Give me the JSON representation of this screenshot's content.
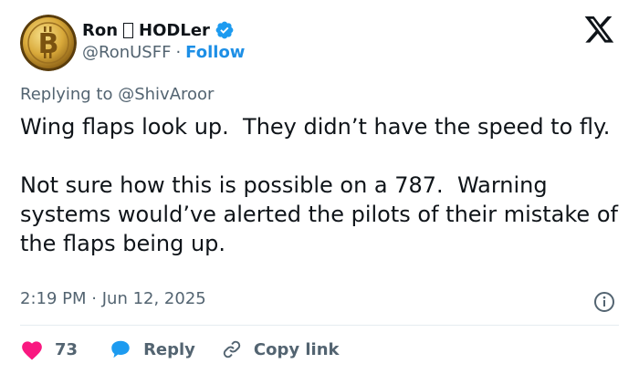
{
  "user": {
    "display_name": "Ron",
    "display_name_suffix": "HODLer",
    "handle": "@RonUSFF",
    "separator": "·",
    "follow_label": "Follow",
    "verified": true
  },
  "tweet": {
    "replying_prefix": "Replying to",
    "replying_handle": "@ShivAroor",
    "text": "Wing flaps look up.  They didn’t have the speed to fly.\n\nNot sure how this is possible on a 787.  Warning systems would’ve alerted the pilots of their mistake of the flaps being up.",
    "time": "2:19 PM",
    "date_separator": "·",
    "date": "Jun 12, 2025"
  },
  "actions": {
    "like_count": "73",
    "reply_label": "Reply",
    "copy_link_label": "Copy link"
  },
  "colors": {
    "accent": "#1d9bf0",
    "like": "#f91880",
    "text": "#0f1419",
    "secondary": "#536471"
  },
  "icons": [
    "bitcoin-avatar",
    "verified-badge-icon",
    "x-logo-icon",
    "info-icon",
    "heart-icon",
    "reply-bubble-icon",
    "link-icon"
  ]
}
